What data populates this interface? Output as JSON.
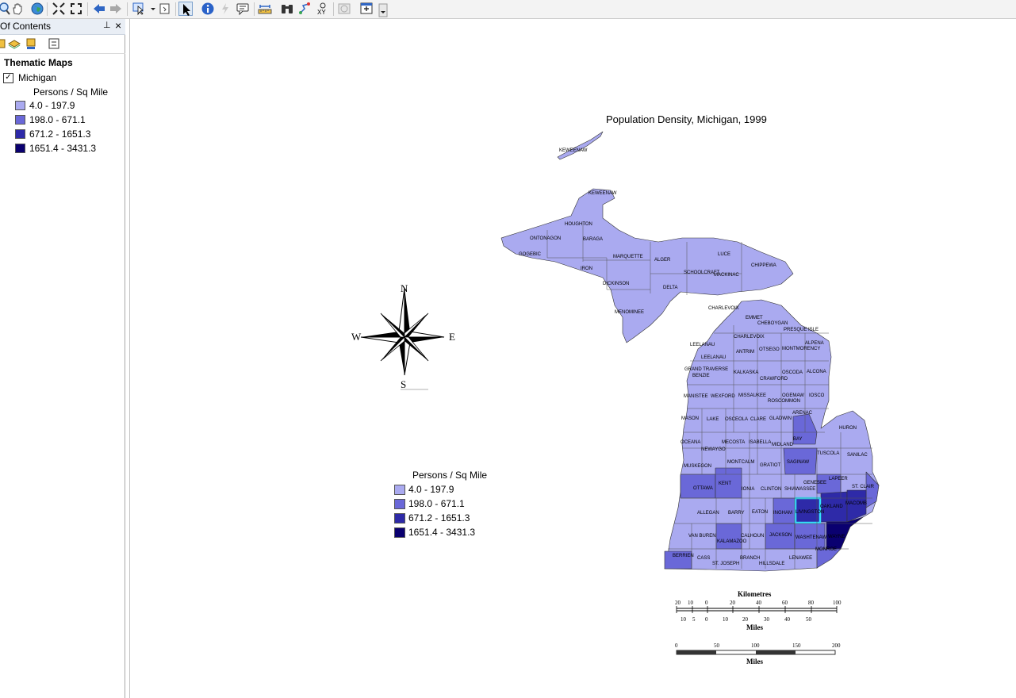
{
  "toolbar": {
    "icons": [
      "zoom-icon",
      "pan-icon",
      "globe-icon",
      "full-extent-icon",
      "fixed-zoom-icon",
      "back-icon",
      "forward-icon",
      "select-features-icon",
      "clear-selection-icon",
      "select-arrow-icon",
      "identify-icon",
      "hyperlink-icon",
      "html-popup-icon",
      "measure-icon",
      "find-icon",
      "find-route-icon",
      "go-to-xy-icon",
      "time-slider-icon",
      "viewer-icon"
    ]
  },
  "toc": {
    "title": "Of Contents",
    "pin_glyph": "⊥",
    "close_glyph": "×",
    "group": "Thematic Maps",
    "layer_name": "Michigan",
    "layer_checked": "✓",
    "field": "Persons / Sq Mile",
    "classes": [
      {
        "label": "4.0 - 197.9",
        "color": "#aaaaf0"
      },
      {
        "label": "198.0 - 671.1",
        "color": "#6a68d8"
      },
      {
        "label": "671.2 - 1651.3",
        "color": "#2e2aa8"
      },
      {
        "label": "1651.4 - 3431.3",
        "color": "#0a0070"
      }
    ]
  },
  "map": {
    "title": "Population Density, Michigan, 1999",
    "legend_title": "Persons / Sq Mile",
    "legend": [
      {
        "label": "4.0 - 197.9",
        "color": "#aaaaf0"
      },
      {
        "label": "198.0 - 671.1",
        "color": "#6a68d8"
      },
      {
        "label": "671.2 - 1651.3",
        "color": "#2e2aa8"
      },
      {
        "label": "1651.4 - 3431.3",
        "color": "#0a0070"
      }
    ],
    "north_arrow": {
      "n": "N",
      "s": "S",
      "e": "E",
      "w": "W"
    },
    "highlight_color": "#33e0ff",
    "counties": {
      "upper": [
        "KEWEENAW",
        "KEWEENAW",
        "HOUGHTON",
        "ONTONAGON",
        "BARAGA",
        "GOGEBIC",
        "MARQUETTE",
        "ALGER",
        "LUCE",
        "CHIPPEWA",
        "IRON",
        "SCHOOLCRAFT",
        "MACKINAC",
        "DICKINSON",
        "DELTA",
        "MENOMINEE"
      ],
      "lower": [
        "CHARLEVOIX",
        "EMMET",
        "CHEBOYGAN",
        "PRESQUE ISLE",
        "LEELANAU",
        "CHARLEVOIX",
        "ALPENA",
        "MONTMORENCY",
        "ANTRIM",
        "OTSEGO",
        "LEELANAU",
        "GRAND TRAVERSE",
        "BENZIE",
        "KALKASKA",
        "CRAWFORD",
        "OSCODA",
        "ALCONA",
        "MANISTEE",
        "WEXFORD",
        "MISSAUKEE",
        "ROSCOMMON",
        "OGEMAW",
        "IOSCO",
        "MASON",
        "LAKE",
        "OSCEOLA",
        "CLARE",
        "GLADWIN",
        "ARENAC",
        "HURON",
        "OCEANA",
        "NEWAYGO",
        "MECOSTA",
        "ISABELLA",
        "MIDLAND",
        "BAY",
        "TUSCOLA",
        "SANILAC",
        "MUSKEGON",
        "MONTCALM",
        "GRATIOT",
        "SAGINAW",
        "KENT",
        "GENESEE",
        "LAPEER",
        "ST. CLAIR",
        "OTTAWA",
        "IONIA",
        "CLINTON",
        "SHIAWASSEE",
        "OAKLAND",
        "MACOMB",
        "ALLEGAN",
        "BARRY",
        "EATON",
        "INGHAM",
        "LIVINGSTON",
        "VAN BUREN",
        "KALAMAZOO",
        "CALHOUN",
        "JACKSON",
        "WASHTENAW",
        "WAYNE",
        "BERRIEN",
        "CASS",
        "ST. JOSEPH",
        "BRANCH",
        "HILLSDALE",
        "LENAWEE",
        "MONROE"
      ]
    },
    "scale": {
      "km_title": "Kilometres",
      "km_ticks": [
        "20",
        "10",
        "0",
        "20",
        "40",
        "60",
        "80",
        "100"
      ],
      "mi_ticks": [
        "10",
        "5",
        "0",
        "10",
        "20",
        "30",
        "40",
        "50"
      ],
      "mi_title": "Miles",
      "bar2_ticks": [
        "0",
        "50",
        "100",
        "150",
        "200"
      ],
      "bar2_title": "Miles"
    }
  }
}
